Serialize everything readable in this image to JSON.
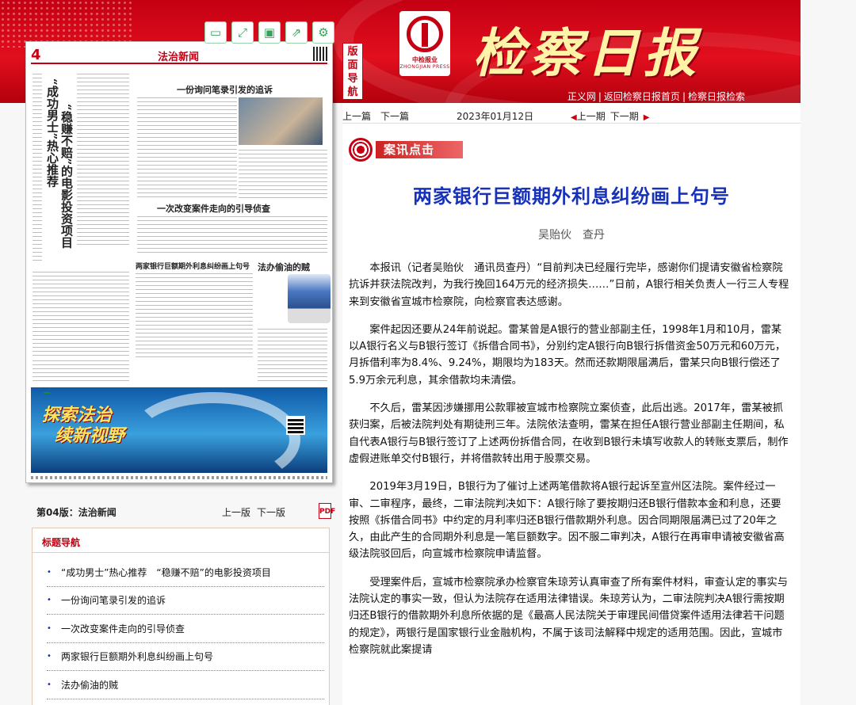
{
  "header": {
    "masthead": "检察日报",
    "press_cn": "中检报业",
    "press_en": "ZHONGJIAN PRESS",
    "side_tab": "版面导航",
    "top_links": [
      "正义网",
      "返回检察日报首页",
      "检察日报检索"
    ]
  },
  "paper_panel": {
    "page_number": "4",
    "page_title": "法治新闻",
    "vertical_headlines": [
      "“成功男士”热心推荐",
      "“稳赚不赔”的电影投资项目"
    ],
    "inner_headlines": [
      "一份询问笔录引发的追诉",
      "一次改变案件走向的引导侦查",
      "两家银行巨额期外利息纠纷画上句号",
      "法办偷油的贼"
    ],
    "ad_slogan_line1": "探索法治",
    "ad_slogan_line2": "续新视野",
    "toolbar_icons": [
      "page-icon",
      "expand-icon",
      "save-icon",
      "share-icon",
      "settings-icon"
    ]
  },
  "page_bar": {
    "label": "第04版：法治新闻",
    "prev": "上一版",
    "next": "下一版",
    "pdf": "PDF"
  },
  "nav_box": {
    "title": "标题导航",
    "items": [
      "“成功男士”热心推荐　“稳赚不赔”的电影投资项目",
      "一份询问笔录引发的追诉",
      "一次改变案件走向的引导侦查",
      "两家银行巨额期外利息纠纷画上句号",
      "法办偷油的贼"
    ]
  },
  "article_nav": {
    "prev_article": "上一篇",
    "next_article": "下一篇",
    "date": "2023年01月12日",
    "prev_issue": "上一期",
    "next_issue": "下一期"
  },
  "article": {
    "section": "案讯点击",
    "title": "两家银行巨额期外利息纠纷画上句号",
    "author": "吴贻伙　查丹",
    "paragraphs": [
      "本报讯（记者吴贻伙　通讯员查丹）“目前判决已经履行完毕，感谢你们提请安徽省检察院抗诉并获法院改判，为我行挽回164万元的经济损失……”日前，A银行相关负责人一行三人专程来到安徽省宣城市检察院，向检察官表达感谢。",
      "案件起因还要从24年前说起。雷某曾是A银行的营业部副主任，1998年1月和10月，雷某以A银行名义与B银行签订《拆借合同书》，分别约定A银行向B银行拆借资金50万元和60万元，月拆借利率为8.4%、9.24%，期限均为183天。然而还款期限届满后，雷某只向B银行偿还了5.9万余元利息，其余借款均未清偿。",
      "不久后，雷某因涉嫌挪用公款罪被宣城市检察院立案侦查，此后出逃。2017年，雷某被抓获归案，后被法院判处有期徒刑三年。法院依法查明，雷某在担任A银行营业部副主任期间，私自代表A银行与B银行签订了上述两份拆借合同，在收到B银行未填写收款人的转账支票后，制作虚假进账单交付B银行，并将借款转出用于股票交易。",
      "2019年3月19日，B银行为了催讨上述两笔借款将A银行起诉至宣州区法院。案件经过一审、二审程序，最终，二审法院判决如下：A银行除了要按期归还B银行借款本金和利息，还要按照《拆借合同书》中约定的月利率归还B银行借款期外利息。因合同期限届满已过了20年之久，由此产生的合同期外利息是一笔巨额数字。因不服二审判决，A银行在再审申请被安徽省高级法院驳回后，向宣城市检察院申请监督。",
      "受理案件后，宣城市检察院承办检察官朱琼芳认真审查了所有案件材料，审查认定的事实与法院认定的事实一致，但认为法院存在适用法律错误。朱琼芳认为，二审法院判决A银行需按期归还B银行的借款期外利息所依据的是《最高人民法院关于审理民间借贷案件适用法律若干问题的规定》，两银行是国家银行业金融机构，不属于该司法解释中规定的适用范围。因此，宣城市检察院就此案提请"
    ]
  },
  "colors": {
    "brand_red": "#c40012",
    "title_blue": "#1732b8",
    "tool_green": "#35a35a"
  }
}
